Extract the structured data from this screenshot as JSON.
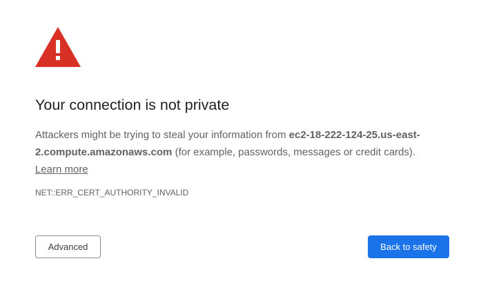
{
  "icons": {
    "warning": "warning-triangle-icon"
  },
  "colors": {
    "warning_red": "#d93025",
    "primary_blue": "#1a73e8",
    "text_gray": "#5f6368",
    "heading": "#202124"
  },
  "interstitial": {
    "title": "Your connection is not private",
    "message_prefix": "Attackers might be trying to steal your information from ",
    "host": "ec2-18-222-124-25.us-east-2.compute.amazonaws.com",
    "message_suffix": " (for example, passwords, messages or credit cards).",
    "learn_more": "Learn more",
    "error_code": "NET::ERR_CERT_AUTHORITY_INVALID"
  },
  "buttons": {
    "advanced": "Advanced",
    "back_to_safety": "Back to safety"
  }
}
